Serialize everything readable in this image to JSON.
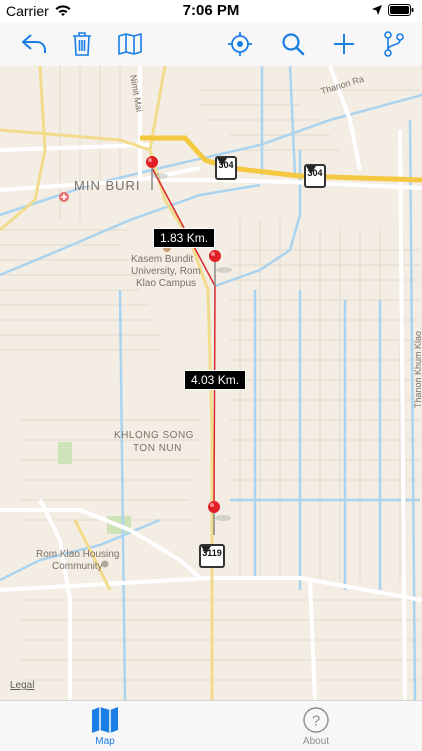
{
  "status": {
    "carrier": "Carrier",
    "time": "7:06 PM"
  },
  "toolbar": {
    "icons": [
      "undo-icon",
      "trash-icon",
      "map-icon",
      "locate-icon",
      "search-icon",
      "add-icon",
      "branch-icon"
    ],
    "accent": "#1a7ee6"
  },
  "map": {
    "labels": {
      "min_buri": "MIN BURI",
      "kasem1": "Kasem Bundit",
      "kasem2": "University, Rom",
      "kasem3": "Klao Campus",
      "khlong1": "KHLONG SONG",
      "khlong2": "TON NUN",
      "romklao1": "Rom Klao Housing",
      "romklao2": "Community",
      "nimit": "Nimit Mai",
      "thanon_ra": "Thanon Ra",
      "thanon_khum": "Thanon Khum Klao",
      "legal": "Legal"
    },
    "distances": {
      "d1": "1.83 Km.",
      "d2": "4.03 Km."
    },
    "routes": {
      "r1": "304",
      "r2": "304",
      "r3": "3119"
    }
  },
  "tabbar": {
    "tabs": [
      {
        "label": "Map",
        "active": true
      },
      {
        "label": "About",
        "active": false
      }
    ]
  }
}
